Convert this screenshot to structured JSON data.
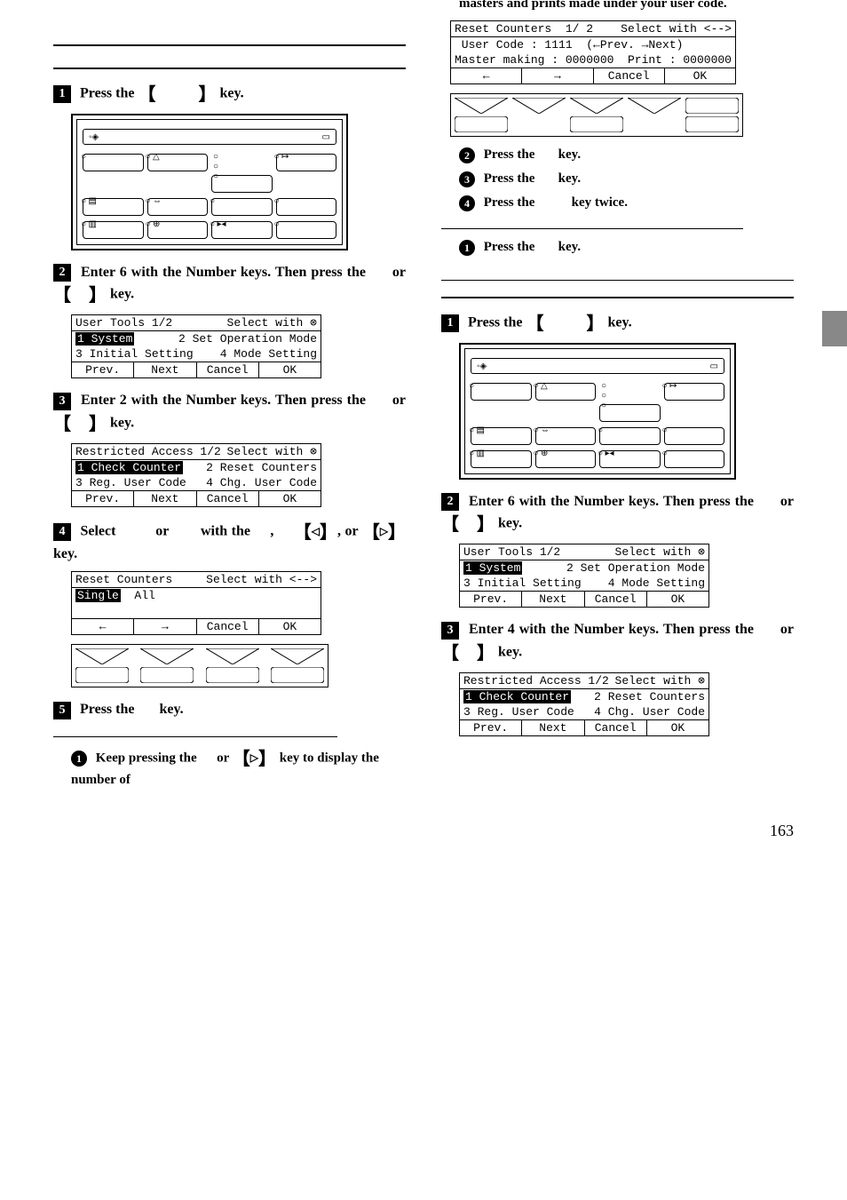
{
  "page_number": "163",
  "left": {
    "step1": "Press the ",
    "step1b": " key.",
    "step2": "Enter 6 with the Number keys. Then press the ",
    "step2b": " or ",
    "step2c": " key.",
    "step3": "Enter 2 with the Number keys. Then press the ",
    "step3b": " or ",
    "step3c": " key.",
    "step4a": "Select ",
    "step4b": " or ",
    "step4c": " with the ",
    "step4d": ", ",
    "step4e": ", or ",
    "step4f": " key.",
    "step5": "Press the ",
    "step5b": " key.",
    "sub1": "Keep pressing the ",
    "sub1b": " or ",
    "sub1c": " key to display the number of",
    "lcd1": {
      "t1": "User Tools 1/2",
      "t1r": "Select with ⊗",
      "r1a": "1 System",
      "r1b": "2 Set Operation Mode",
      "r2a": "3 Initial Setting",
      "r2b": "4 Mode Setting",
      "b1": "Prev.",
      "b2": "Next",
      "b3": "Cancel",
      "b4": "OK"
    },
    "lcd2": {
      "t1": "Restricted Access 1/2",
      "t1r": "Select with ⊗",
      "r1a": "1 Check Counter",
      "r1b": "2 Reset Counters",
      "r2a": "3 Reg. User Code",
      "r2b": "4 Chg. User Code",
      "b1": "Prev.",
      "b2": "Next",
      "b3": "Cancel",
      "b4": "OK"
    },
    "lcd3": {
      "t1": "Reset Counters",
      "t1r": "Select with <-->",
      "r1a": "Single",
      "r1b": "All",
      "b1": "←",
      "b2": "→",
      "b3": "Cancel",
      "b4": "OK"
    }
  },
  "right": {
    "continuation": "masters and prints made under your user code.",
    "lcd4": {
      "t1": "Reset Counters  1/ 2",
      "t1r": "Select with <-->",
      "r1": " User Code : 1111  (←Prev. →Next)",
      "r2a": "Master making : 0000000",
      "r2b": "Print : 0000000",
      "b1": "←",
      "b2": "→",
      "b3": "Cancel",
      "b4": "OK"
    },
    "sub2": "Press the ",
    "sub2b": " key.",
    "sub3": "Press the ",
    "sub3b": " key.",
    "sub4": "Press the ",
    "sub4b": " key twice.",
    "subA": "Press the ",
    "subAb": " key.",
    "step1": "Press the ",
    "step1b": " key.",
    "step2": "Enter 6 with the Number keys. Then press the ",
    "step2b": " or ",
    "step2c": " key.",
    "step3": "Enter 4 with the Number keys. Then press the ",
    "step3b": " or ",
    "step3c": " key.",
    "lcd5": {
      "t1": "User Tools 1/2",
      "t1r": "Select with ⊗",
      "r1a": "1 System",
      "r1b": "2 Set Operation Mode",
      "r2a": "3 Initial Setting",
      "r2b": "4 Mode Setting",
      "b1": "Prev.",
      "b2": "Next",
      "b3": "Cancel",
      "b4": "OK"
    },
    "lcd6": {
      "t1": "Restricted Access 1/2",
      "t1r": "Select with ⊗",
      "r1a": "1 Check Counter",
      "r1b": "2 Reset Counters",
      "r2a": "3 Reg. User Code",
      "r2b": "4 Chg. User Code",
      "b1": "Prev.",
      "b2": "Next",
      "b3": "Cancel",
      "b4": "OK"
    }
  }
}
